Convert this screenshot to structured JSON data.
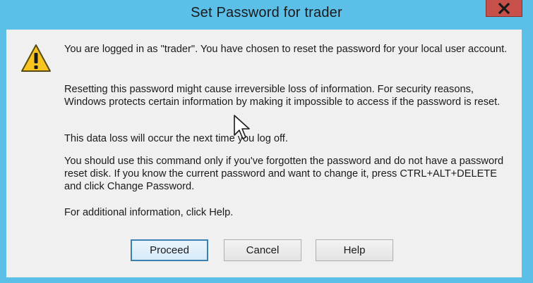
{
  "window": {
    "title": "Set Password for trader",
    "close_glyph": "✕"
  },
  "dialog": {
    "icon": "warning-icon",
    "paragraphs": [
      "You are logged in as \"trader\". You have chosen to reset the password for your local user account.",
      "Resetting this password might cause irreversible loss of information. For security reasons, Windows protects certain information by making it impossible to access if the password is reset.",
      "This data loss will occur the next time you log off.",
      "You should use this command only if you've forgotten the password and do not have a password reset disk. If you know the current password and want to change it, press CTRL+ALT+DELETE and click Change Password.",
      "For additional information, click Help."
    ]
  },
  "buttons": {
    "proceed": "Proceed",
    "cancel": "Cancel",
    "help": "Help"
  },
  "colors": {
    "frame": "#5bbfe8",
    "close": "#c7504b",
    "client": "#f0f0f0",
    "default_button_border": "#3c7fb1"
  }
}
